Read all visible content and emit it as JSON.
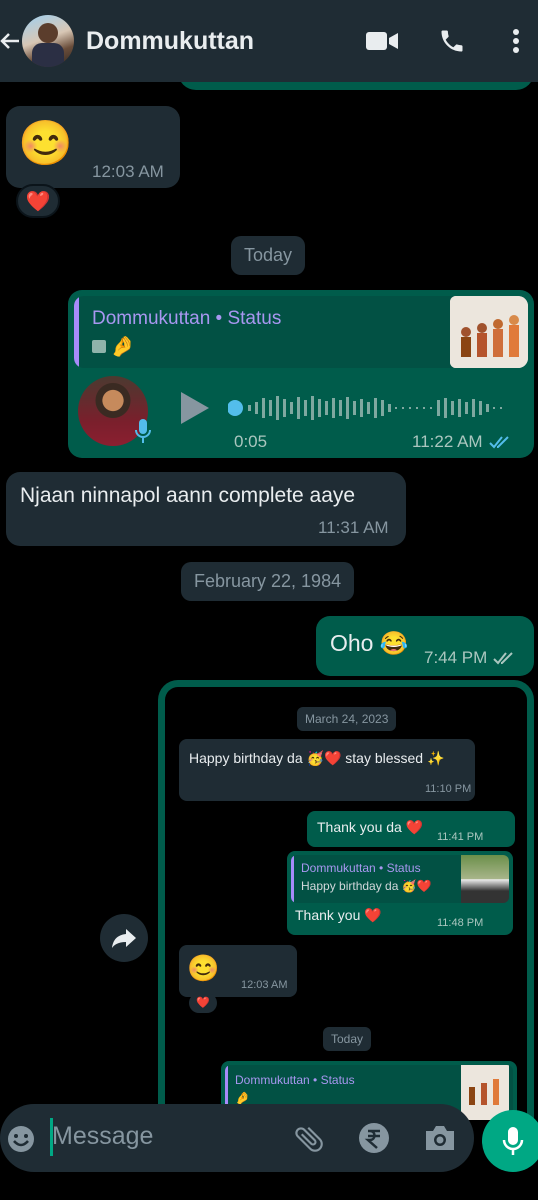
{
  "header": {
    "contact_name": "Dommukuttan",
    "icons": [
      "back-arrow-icon",
      "avatar",
      "video-call-icon",
      "voice-call-icon",
      "more-options-icon"
    ]
  },
  "messages": {
    "smile_time": "12:03 AM",
    "smile_emoji": "😊",
    "smile_reaction": "❤️",
    "today_chip": "Today",
    "status_reply": {
      "quoted_name": "Dommukuttan • Status",
      "quoted_caption": "🤌",
      "voice_duration": "0:05",
      "time": "11:22 AM"
    },
    "incoming_text": "Njaan ninnapol aann complete aaye",
    "incoming_time": "11:31 AM",
    "date_chip_2": "February 22, 1984",
    "oho_text": "Oho 😂",
    "oho_time": "7:44 PM"
  },
  "nested": {
    "date_chip": "March 24, 2023",
    "bday_text": "Happy birthday da 🥳❤️ stay blessed ✨",
    "bday_time": "11:10 PM",
    "thanks_text": "Thank you da ❤️",
    "thanks_time": "11:41 PM",
    "status_quote_name": "Dommukuttan • Status",
    "status_quote_caption": "Happy birthday da 🥳❤️",
    "thank_you_text": "Thank you ❤️",
    "thank_you_time": "11:48 PM",
    "smile_emoji": "😊",
    "smile_time": "12:03 AM",
    "reaction": "❤️",
    "today_chip": "Today",
    "last_quote_name": "Dommukuttan • Status",
    "last_quote_caption": "🤌"
  },
  "input": {
    "placeholder": "Message"
  },
  "colors": {
    "outgoing": "#005c4b",
    "incoming": "#1f2c34",
    "accent": "#00a884",
    "read_ticks": "#53bdeb"
  }
}
